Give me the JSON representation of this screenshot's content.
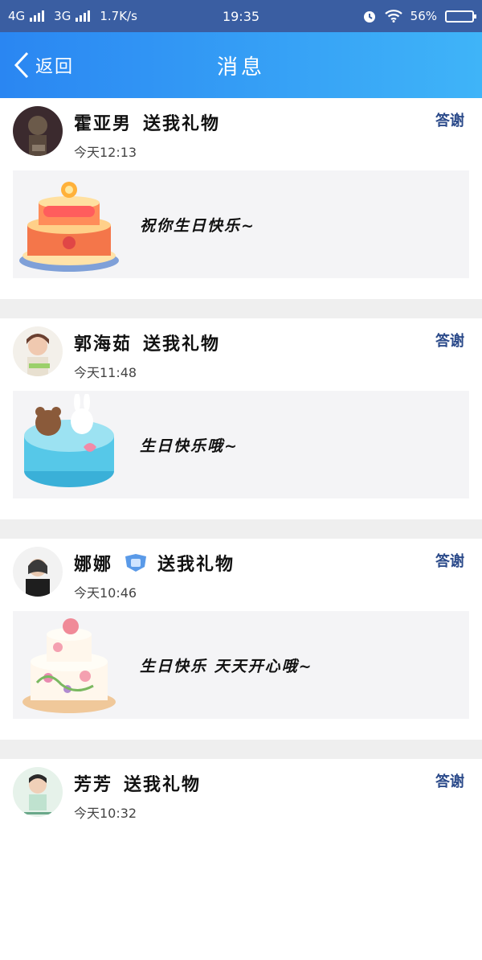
{
  "status": {
    "net1": "4G",
    "net2": "3G",
    "speed": "1.7K/s",
    "time": "19:35",
    "battery": "56%",
    "battery_level": 0.56
  },
  "nav": {
    "back_label": "返回",
    "title": "消息"
  },
  "messages": [
    {
      "sender": "霍亚男",
      "action": "送我礼物",
      "time": "今天12:13",
      "thank": "答谢",
      "wish": "祝你生日快乐~",
      "cake_icon": "birthday-cake-orange-icon"
    },
    {
      "sender": "郭海茹",
      "action": "送我礼物",
      "time": "今天11:48",
      "thank": "答谢",
      "wish": "生日快乐哦~",
      "cake_icon": "birthday-cake-blue-icon"
    },
    {
      "sender": "娜娜",
      "action": "送我礼物",
      "time": "今天10:46",
      "thank": "答谢",
      "wish": "生日快乐 天天开心哦~",
      "cake_icon": "birthday-cake-flower-icon"
    },
    {
      "sender": "芳芳",
      "action": "送我礼物",
      "time": "今天10:32",
      "thank": "答谢"
    }
  ]
}
